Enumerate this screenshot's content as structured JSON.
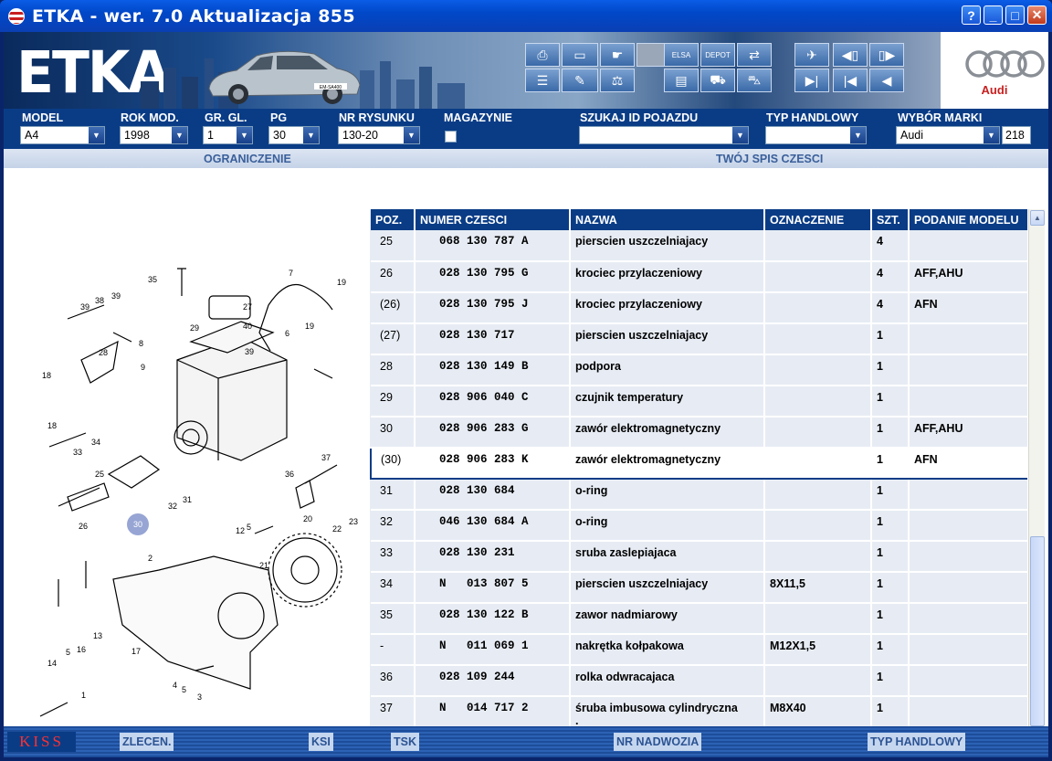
{
  "window": {
    "title": "ETKA - wer. 7.0 Aktualizacja 855",
    "buttons": [
      "?",
      "_",
      "□",
      "✕"
    ]
  },
  "banner": {
    "logo": "ETKA",
    "brand_text": "Audi",
    "car_plate": "EM-SA400"
  },
  "filters": {
    "model": {
      "label": "MODEL",
      "value": "A4"
    },
    "rok_mod": {
      "label": "ROK MOD.",
      "value": "1998"
    },
    "gr_gl": {
      "label": "GR. GL.",
      "value": "1"
    },
    "pg": {
      "label": "PG",
      "value": "30"
    },
    "nr_rysunku": {
      "label": "NR RYSUNKU",
      "value": "130-20"
    },
    "magazynie": {
      "label": "MAGAZYNIE"
    },
    "szukaj_id": {
      "label": "SZUKAJ ID POJAZDU",
      "value": ""
    },
    "typ_handlowy": {
      "label": "TYP HANDLOWY",
      "value": ""
    },
    "wybor_marki": {
      "label": "WYBÓR MARKI",
      "value": "Audi",
      "number": "218"
    }
  },
  "section": {
    "left": "OGRANICZENIE",
    "right": "TWÓJ SPIS CZESCI"
  },
  "table": {
    "columns": [
      "POZ.",
      "NUMER CZESCI",
      "NAZWA",
      "OZNACZENIE",
      "SZT.",
      "PODANIE MODELU"
    ],
    "rows": [
      {
        "poz": "25",
        "num": "068 130 787 A",
        "name": "pierscien uszczelniajacy",
        "ozn": "",
        "szt": "4",
        "mod": ""
      },
      {
        "poz": "26",
        "num": "028 130 795 G",
        "name": "krociec przylaczeniowy",
        "ozn": "",
        "szt": "4",
        "mod": "AFF,AHU"
      },
      {
        "poz": "(26)",
        "num": "028 130 795 J",
        "name": "krociec przylaczeniowy",
        "ozn": "",
        "szt": "4",
        "mod": "AFN"
      },
      {
        "poz": "(27)",
        "num": "028 130 717",
        "name": "pierscien uszczelniajacy",
        "ozn": "",
        "szt": "1",
        "mod": ""
      },
      {
        "poz": "28",
        "num": "028 130 149 B",
        "name": "podpora",
        "ozn": "",
        "szt": "1",
        "mod": ""
      },
      {
        "poz": "29",
        "num": "028 906 040 C",
        "name": "czujnik temperatury",
        "ozn": "",
        "szt": "1",
        "mod": ""
      },
      {
        "poz": "30",
        "num": "028 906 283 G",
        "name": "zawór elektromagnetyczny",
        "ozn": "",
        "szt": "1",
        "mod": "AFF,AHU"
      },
      {
        "poz": "(30)",
        "num": "028 906 283 K",
        "name": "zawór elektromagnetyczny",
        "ozn": "",
        "szt": "1",
        "mod": "AFN",
        "selected": true
      },
      {
        "poz": "31",
        "num": "028 130 684",
        "name": "o-ring",
        "ozn": "",
        "szt": "1",
        "mod": ""
      },
      {
        "poz": "32",
        "num": "046 130 684 A",
        "name": "o-ring",
        "ozn": "",
        "szt": "1",
        "mod": ""
      },
      {
        "poz": "33",
        "num": "028 130 231",
        "name": "sruba zaslepiajaca",
        "ozn": "",
        "szt": "1",
        "mod": ""
      },
      {
        "poz": "34",
        "num": "N   013 807 5",
        "name": "pierscien uszczelniajacy",
        "ozn": "8X11,5",
        "szt": "1",
        "mod": ""
      },
      {
        "poz": "35",
        "num": "028 130 122 B",
        "name": "zawor nadmiarowy",
        "ozn": "",
        "szt": "1",
        "mod": ""
      },
      {
        "poz": "-",
        "num": "N   011 069 1",
        "name": "nakrętka kołpakowa",
        "ozn": "M12X1,5",
        "szt": "1",
        "mod": ""
      },
      {
        "poz": "36",
        "num": "028 109 244",
        "name": "rolka odwracajaca",
        "ozn": "",
        "szt": "1",
        "mod": ""
      },
      {
        "poz": "37",
        "num": "N   014 717 2",
        "name": "śruba imbusowa cylindryczna",
        "name2": ".",
        "ozn": "M8X40",
        "szt": "1",
        "mod": ""
      }
    ]
  },
  "diagram": {
    "labels": [
      "7",
      "19",
      "35",
      "27",
      "39",
      "38",
      "39",
      "40",
      "8",
      "29",
      "6",
      "19",
      "39",
      "28",
      "9",
      "18",
      "18",
      "34",
      "33",
      "25",
      "26",
      "32",
      "31",
      "36",
      "37",
      "30",
      "12",
      "5",
      "20",
      "22",
      "23",
      "2",
      "21",
      "13",
      "5",
      "16",
      "17",
      "14",
      "4",
      "5",
      "3",
      "1"
    ],
    "highlight": "30"
  },
  "statusbar": {
    "kiss": "KISS",
    "buttons": [
      "ZLECEN.",
      "KSI",
      "TSK",
      "NR NADWOZIA",
      "TYP HANDLOWY"
    ]
  },
  "colors": {
    "navy": "#0a3c86",
    "accent_red": "#c81f1f"
  }
}
